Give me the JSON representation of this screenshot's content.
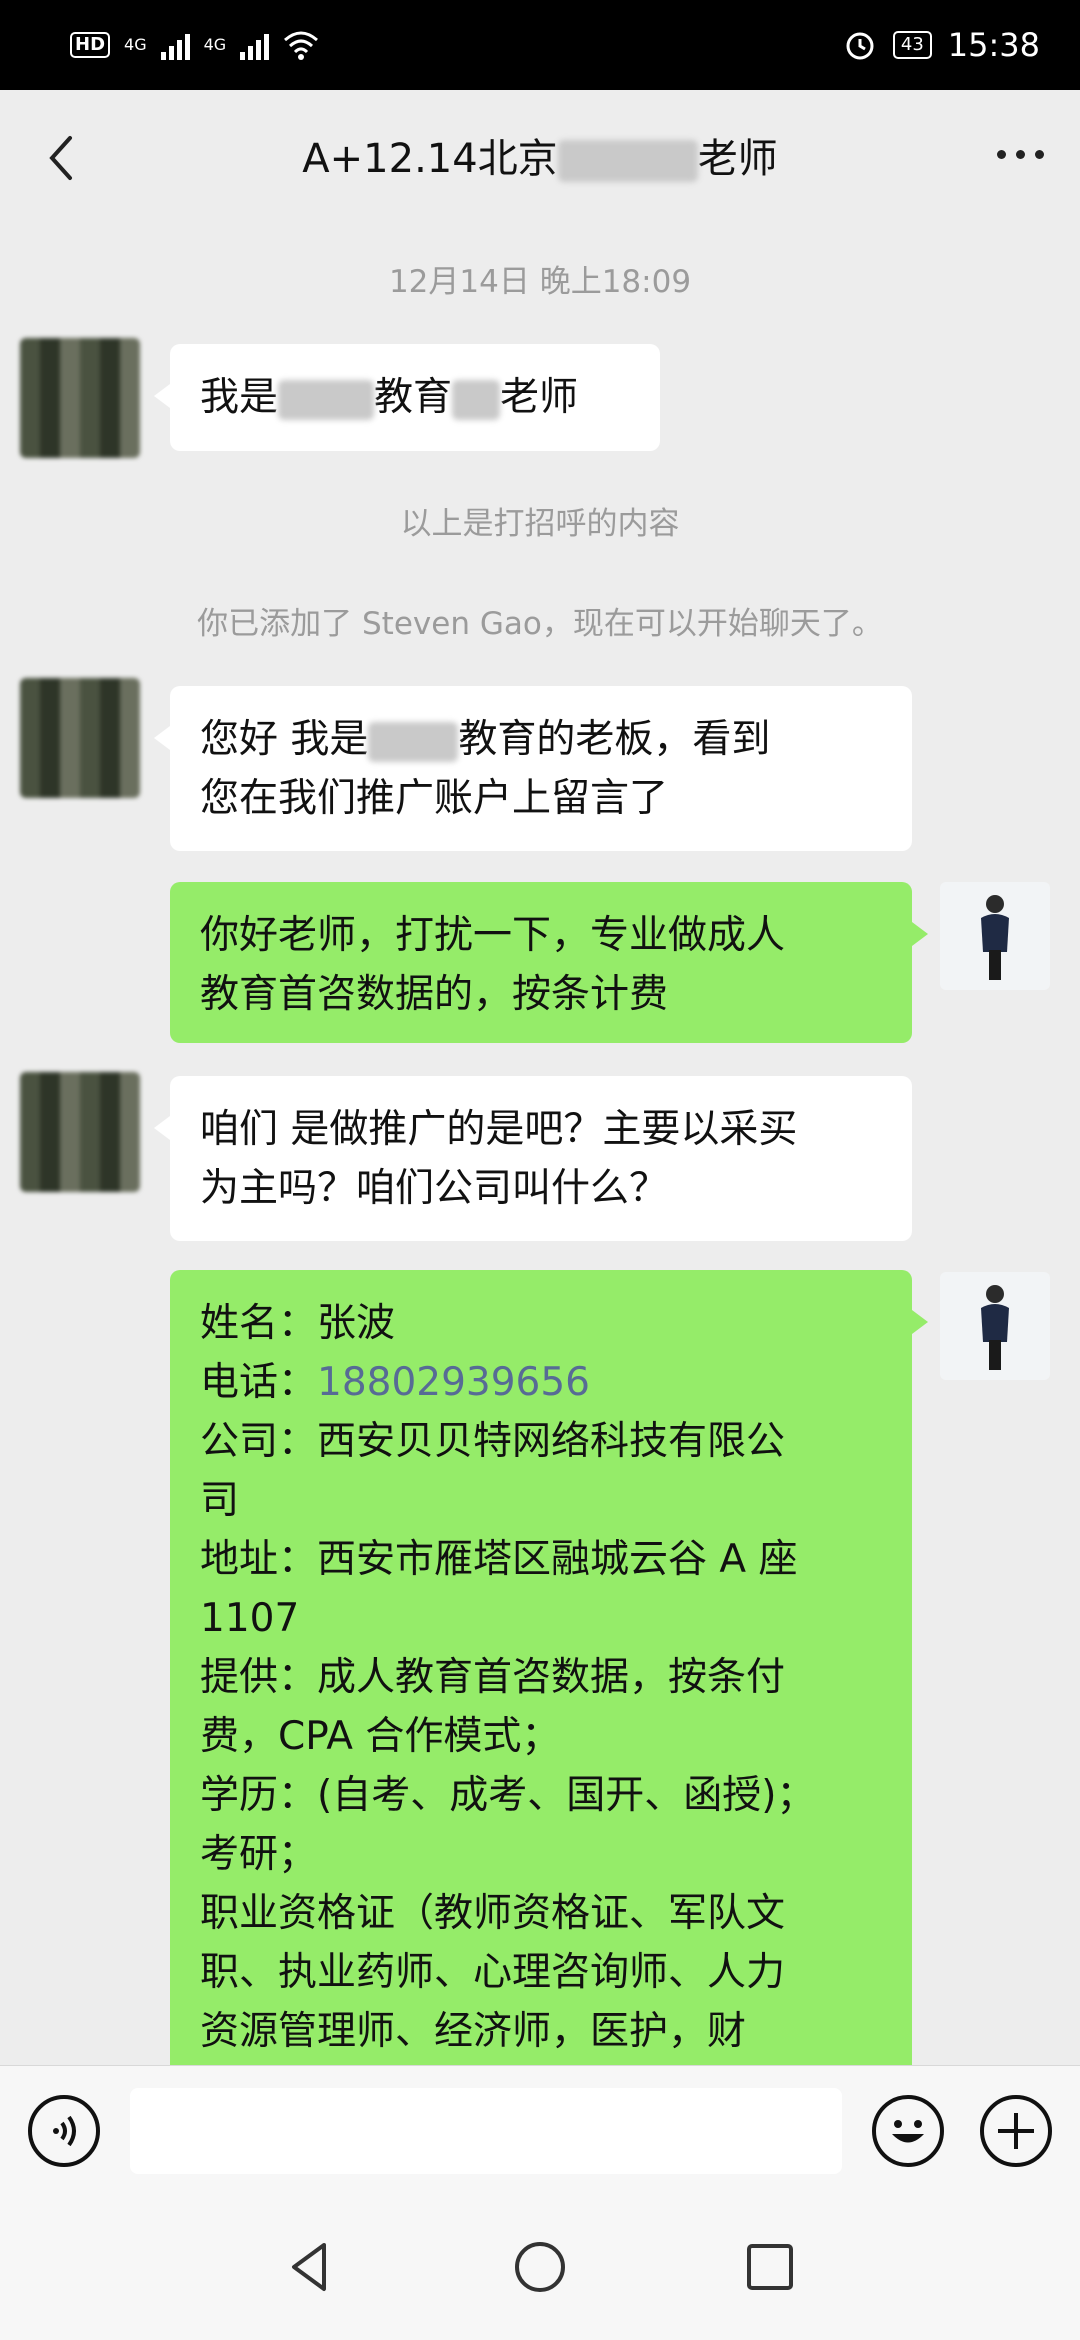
{
  "status_bar": {
    "network": "4G",
    "network2": "4G",
    "battery": "43",
    "time": "15:38"
  },
  "header": {
    "title_prefix": "A+12.14北京",
    "title_suffix": "老师"
  },
  "messages": {
    "timestamp": "12月14日 晚上18:09",
    "m1_part1": "我是",
    "m1_part2": "教育",
    "m1_part3": "老师",
    "sys1": "以上是打招呼的内容",
    "sys2": "你已添加了 Steven Gao，现在可以开始聊天了。",
    "m2_l1a": "您好 我是",
    "m2_l1b": "教育的老板，看到",
    "m2_l2": "您在我们推广账户上留言了",
    "m3_l1": "你好老师，打扰一下，专业做成人",
    "m3_l2": "教育首咨数据的，按条计费",
    "m4_l1": "咱们 是做推广的是吧？主要以采买",
    "m4_l2": "为主吗？咱们公司叫什么？",
    "m5_lines": [
      "姓名：张波",
      "电话：",
      "公司：西安贝贝特网络科技有限公",
      "司",
      "地址：西安市雁塔区融城云谷 A 座",
      "1107",
      "提供：成人教育首咨数据，按条付",
      "费，CPA 合作模式；",
      "学历：(自考、成考、国开、函授)；",
      "考研；",
      "职业资格证（教师资格证、军队文",
      "职、执业药师、心理咨询师、人力",
      "资源管理师、经济师，医护，财"
    ],
    "m5_phone": "18802939656"
  },
  "icons": {
    "back": "back-arrow-icon",
    "more": "more-dots-icon",
    "voice": "voice-icon",
    "emoji": "emoji-icon",
    "plus": "plus-icon"
  },
  "colors": {
    "green_bubble": "#95ec69",
    "link": "#576b95",
    "background": "#ededed"
  }
}
